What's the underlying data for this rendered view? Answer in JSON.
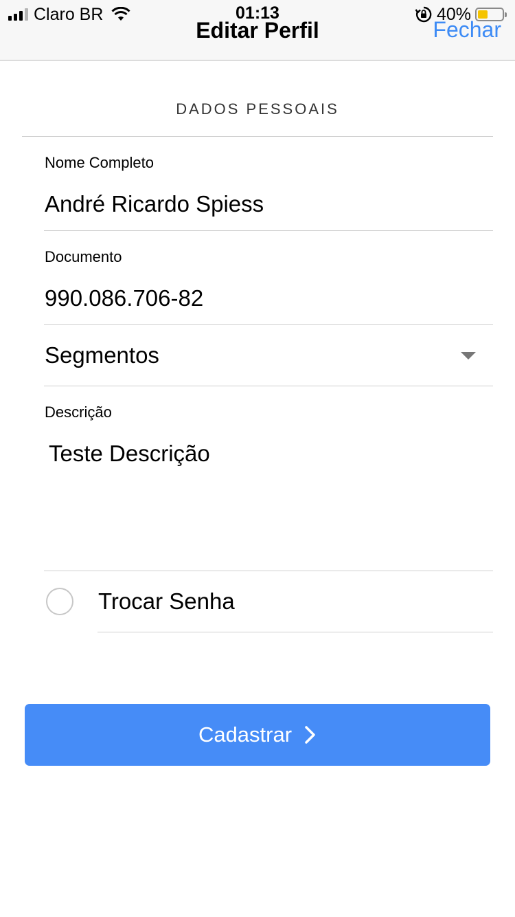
{
  "status_bar": {
    "carrier": "Claro BR",
    "time": "01:13",
    "battery": "40%",
    "battery_level": 0.4,
    "battery_color": "#f5c400"
  },
  "header": {
    "title": "Editar Perfil",
    "close_label": "Fechar",
    "accent_color": "#3d8bf5"
  },
  "form": {
    "section_title": "DADOS PESSOAIS",
    "full_name": {
      "label": "Nome Completo",
      "value": "André Ricardo Spiess"
    },
    "document": {
      "label": "Documento",
      "value": "990.086.706-82"
    },
    "segments": {
      "value": "Segmentos",
      "icon": "chevron-down-icon"
    },
    "description": {
      "label": "Descrição",
      "value": "Teste Descrição"
    },
    "change_password": {
      "label": "Trocar Senha",
      "checked": false
    }
  },
  "submit": {
    "label": "Cadastrar",
    "icon": "chevron-right-icon",
    "color": "#468cf7"
  }
}
